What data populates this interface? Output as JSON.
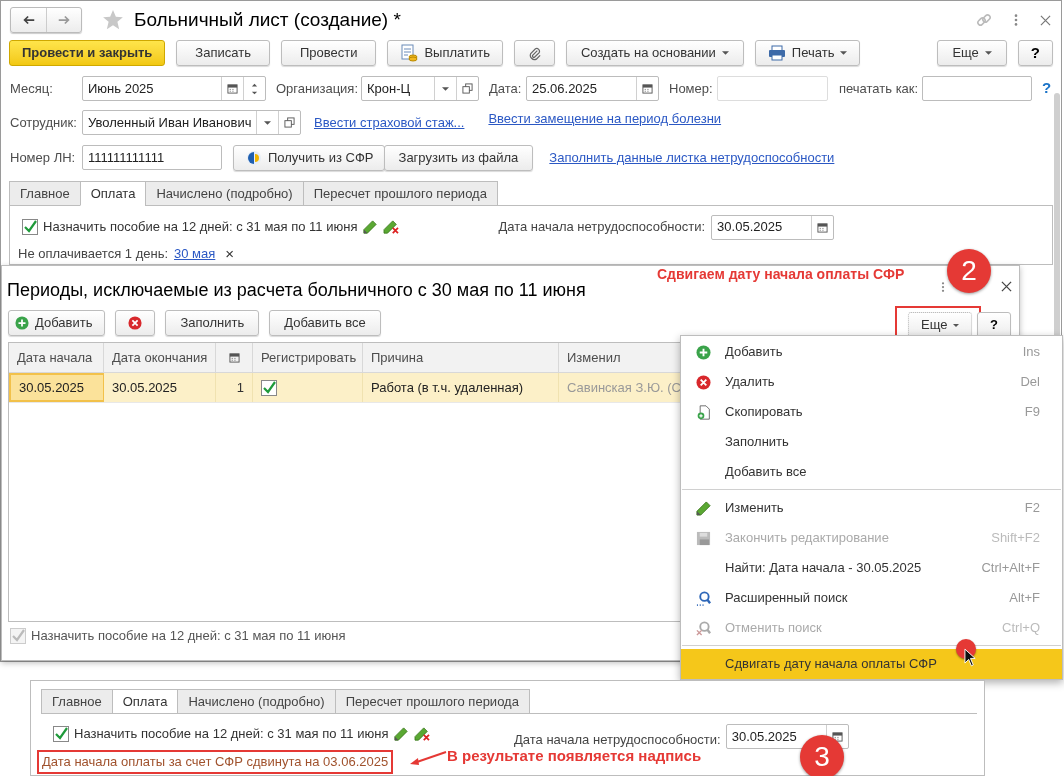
{
  "window": {
    "title": "Больничный лист (создание) *"
  },
  "toolbar": [
    {
      "kind": "primary",
      "label": "Провести и закрыть"
    },
    {
      "kind": "plain",
      "label": "Записать"
    },
    {
      "kind": "plain",
      "label": "Провести"
    },
    {
      "kind": "pay",
      "label": "Выплатить"
    },
    {
      "kind": "attach"
    },
    {
      "kind": "menu",
      "label": "Создать на основании"
    },
    {
      "kind": "print",
      "label": "Печать"
    }
  ],
  "toolbar_right": [
    {
      "kind": "menu",
      "label": "Еще"
    },
    {
      "kind": "help",
      "label": "?"
    }
  ],
  "form": {
    "month": {
      "label": "Месяц:",
      "value": "Июнь 2025"
    },
    "organization": {
      "label": "Организация:",
      "value": "Крон-Ц"
    },
    "date": {
      "label": "Дата:",
      "value": "25.06.2025"
    },
    "number": {
      "label": "Номер:"
    },
    "print_as": {
      "label": "печатать как:"
    },
    "help_link": "?",
    "employee": {
      "label": "Сотрудник:",
      "value": "Уволенный Иван Иванович"
    },
    "employee_links": [
      "Ввести страховой стаж...",
      "Ввести замещение на период болезни"
    ],
    "sick_leave_number": {
      "label": "Номер ЛН:",
      "value": "111111111111"
    },
    "sfr_buttons": [
      {
        "kind": "sfr",
        "label": "Получить из СФР"
      },
      {
        "kind": "plain",
        "label": "Загрузить из файла"
      }
    ],
    "fill_link": "Заполнить данные листка нетрудоспособности"
  },
  "tabs": [
    {
      "label": "Главное",
      "selected": false
    },
    {
      "label": "Оплата",
      "selected": true
    },
    {
      "label": "Начислено (подробно)",
      "selected": false
    },
    {
      "label": "Пересчет прошлого периода",
      "selected": false
    }
  ],
  "payment": {
    "benefit": {
      "checked": true,
      "label": "Назначить пособие на 12 дней: с 31 мая по 11 июня"
    },
    "start_date": {
      "label": "Дата начала нетрудоспособности:",
      "value": "30.05.2025"
    },
    "unpaid": {
      "label": "Не оплачивается 1 день:",
      "link": "30 мая",
      "remove": "×"
    }
  },
  "dialog": {
    "title": "Периоды, исключаемые из расчета больничного с 30 мая по 11 июня",
    "callout": "Сдвигаем дату начала оплаты СФР",
    "badge": "2",
    "buttons": [
      {
        "kind": "add",
        "label": "Добавить"
      },
      {
        "kind": "delete"
      },
      {
        "kind": "plain",
        "label": "Заполнить"
      },
      {
        "kind": "plain",
        "label": "Добавить все"
      }
    ],
    "more_button": {
      "label": "Еще",
      "outlined": true
    },
    "help_button": "?",
    "table": {
      "columns": [
        {
          "kind": "text",
          "label": "Дата начала"
        },
        {
          "kind": "text",
          "label": "Дата окончания"
        },
        {
          "kind": "calendar"
        },
        {
          "kind": "text",
          "label": "Регистрировать"
        },
        {
          "kind": "text",
          "label": "Причина"
        },
        {
          "kind": "text",
          "label": "Изменил"
        }
      ],
      "rows": [
        {
          "selected": true,
          "cells": [
            {
              "kind": "text",
              "text": "30.05.2025",
              "focused": true
            },
            {
              "kind": "text",
              "text": "30.05.2025"
            },
            {
              "kind": "number",
              "text": "1"
            },
            {
              "kind": "check",
              "checked": true
            },
            {
              "kind": "text",
              "text": "Работа (в т.ч. удаленная)"
            },
            {
              "kind": "muted",
              "text": "Савинская З.Ю. (С"
            }
          ]
        }
      ]
    },
    "benefit": {
      "checked": true,
      "disabled": true,
      "label": "Назначить пособие на 12 дней: с 31 мая по 11 июня"
    }
  },
  "menu": [
    {
      "kind": "add",
      "label": "Добавить",
      "shortcut": "Ins",
      "disabled": false,
      "selected": false
    },
    {
      "kind": "delete",
      "label": "Удалить",
      "shortcut": "Del",
      "disabled": false,
      "selected": false
    },
    {
      "kind": "copy",
      "label": "Скопировать",
      "shortcut": "F9",
      "disabled": false,
      "selected": false
    },
    {
      "kind": "plain",
      "label": "Заполнить",
      "disabled": false,
      "selected": false
    },
    {
      "kind": "plain",
      "label": "Добавить все",
      "disabled": false,
      "selected": false
    },
    {
      "kind": "separator"
    },
    {
      "kind": "edit",
      "label": "Изменить",
      "shortcut": "F2",
      "disabled": false,
      "selected": false
    },
    {
      "kind": "save",
      "label": "Закончить редактирование",
      "shortcut": "Shift+F2",
      "disabled": true,
      "selected": false
    },
    {
      "kind": "plain",
      "label": "Найти: Дата начала - 30.05.2025",
      "shortcut": "Ctrl+Alt+F",
      "disabled": false,
      "selected": false
    },
    {
      "kind": "search",
      "label": "Расширенный поиск",
      "shortcut": "Alt+F",
      "disabled": false,
      "selected": false
    },
    {
      "kind": "search-cancel",
      "label": "Отменить поиск",
      "shortcut": "Ctrl+Q",
      "disabled": true,
      "selected": false
    },
    {
      "kind": "separator"
    },
    {
      "kind": "plain",
      "label": "Сдвигать дату начала оплаты СФР",
      "disabled": false,
      "selected": true
    }
  ],
  "result": {
    "tabs": [
      {
        "label": "Главное",
        "selected": false
      },
      {
        "label": "Оплата",
        "selected": true
      },
      {
        "label": "Начислено (подробно)",
        "selected": false
      },
      {
        "label": "Пересчет прошлого периода",
        "selected": false
      }
    ],
    "benefit": {
      "checked": true,
      "label": "Назначить пособие на 12 дней: с 31 мая по 11 июня"
    },
    "start_date": {
      "label": "Дата начала нетрудоспособности:",
      "value": "30.05.2025"
    },
    "notice": "Дата начала оплаты за счет СФР сдвинута на 03.06.2025",
    "callout": "В результате появляется надпись",
    "badge": "3"
  }
}
